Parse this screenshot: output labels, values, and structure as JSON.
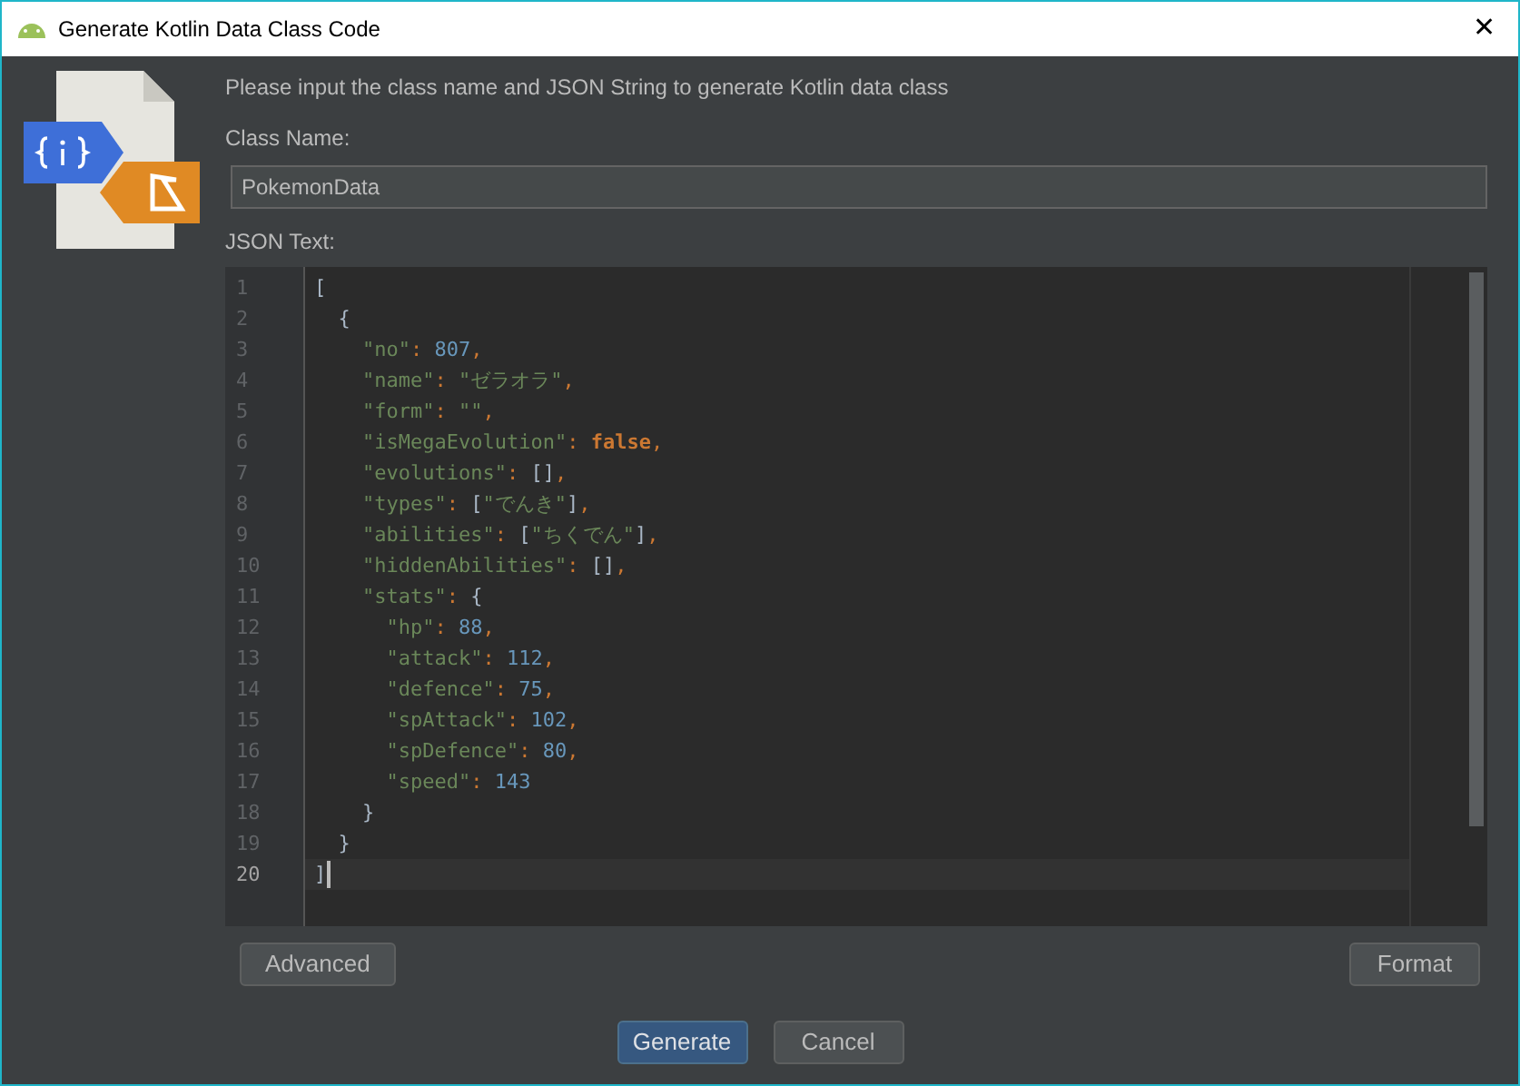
{
  "window": {
    "title": "Generate Kotlin Data Class Code",
    "close": "✕"
  },
  "instruction": "Please input the class name and JSON String to generate Kotlin data class",
  "class_name": {
    "label": "Class Name:",
    "value": "PokemonData"
  },
  "json_text": {
    "label": "JSON Text:",
    "lines": [
      {
        "number": "1",
        "current": false,
        "tokens": [
          {
            "kind": "bracket",
            "text": "["
          }
        ]
      },
      {
        "number": "2",
        "current": false,
        "tokens": [
          {
            "kind": "bracket",
            "text": "  {"
          }
        ]
      },
      {
        "number": "3",
        "current": false,
        "tokens": [
          {
            "kind": "key",
            "text": "    \"no\""
          },
          {
            "kind": "punct",
            "text": ": "
          },
          {
            "kind": "number",
            "text": "807"
          },
          {
            "kind": "punct",
            "text": ","
          }
        ]
      },
      {
        "number": "4",
        "current": false,
        "tokens": [
          {
            "kind": "key",
            "text": "    \"name\""
          },
          {
            "kind": "punct",
            "text": ": "
          },
          {
            "kind": "string",
            "text": "\"ゼラオラ\""
          },
          {
            "kind": "punct",
            "text": ","
          }
        ]
      },
      {
        "number": "5",
        "current": false,
        "tokens": [
          {
            "kind": "key",
            "text": "    \"form\""
          },
          {
            "kind": "punct",
            "text": ": "
          },
          {
            "kind": "string",
            "text": "\"\""
          },
          {
            "kind": "punct",
            "text": ","
          }
        ]
      },
      {
        "number": "6",
        "current": false,
        "tokens": [
          {
            "kind": "key",
            "text": "    \"isMegaEvolution\""
          },
          {
            "kind": "punct",
            "text": ": "
          },
          {
            "kind": "keyword",
            "text": "false"
          },
          {
            "kind": "punct",
            "text": ","
          }
        ]
      },
      {
        "number": "7",
        "current": false,
        "tokens": [
          {
            "kind": "key",
            "text": "    \"evolutions\""
          },
          {
            "kind": "punct",
            "text": ": "
          },
          {
            "kind": "bracket",
            "text": "[]"
          },
          {
            "kind": "punct",
            "text": ","
          }
        ]
      },
      {
        "number": "8",
        "current": false,
        "tokens": [
          {
            "kind": "key",
            "text": "    \"types\""
          },
          {
            "kind": "punct",
            "text": ": "
          },
          {
            "kind": "bracket",
            "text": "["
          },
          {
            "kind": "string",
            "text": "\"でんき\""
          },
          {
            "kind": "bracket",
            "text": "]"
          },
          {
            "kind": "punct",
            "text": ","
          }
        ]
      },
      {
        "number": "9",
        "current": false,
        "tokens": [
          {
            "kind": "key",
            "text": "    \"abilities\""
          },
          {
            "kind": "punct",
            "text": ": "
          },
          {
            "kind": "bracket",
            "text": "["
          },
          {
            "kind": "string",
            "text": "\"ちくでん\""
          },
          {
            "kind": "bracket",
            "text": "]"
          },
          {
            "kind": "punct",
            "text": ","
          }
        ]
      },
      {
        "number": "10",
        "current": false,
        "tokens": [
          {
            "kind": "key",
            "text": "    \"hiddenAbilities\""
          },
          {
            "kind": "punct",
            "text": ": "
          },
          {
            "kind": "bracket",
            "text": "[]"
          },
          {
            "kind": "punct",
            "text": ","
          }
        ]
      },
      {
        "number": "11",
        "current": false,
        "tokens": [
          {
            "kind": "key",
            "text": "    \"stats\""
          },
          {
            "kind": "punct",
            "text": ": "
          },
          {
            "kind": "bracket",
            "text": "{"
          }
        ]
      },
      {
        "number": "12",
        "current": false,
        "tokens": [
          {
            "kind": "key",
            "text": "      \"hp\""
          },
          {
            "kind": "punct",
            "text": ": "
          },
          {
            "kind": "number",
            "text": "88"
          },
          {
            "kind": "punct",
            "text": ","
          }
        ]
      },
      {
        "number": "13",
        "current": false,
        "tokens": [
          {
            "kind": "key",
            "text": "      \"attack\""
          },
          {
            "kind": "punct",
            "text": ": "
          },
          {
            "kind": "number",
            "text": "112"
          },
          {
            "kind": "punct",
            "text": ","
          }
        ]
      },
      {
        "number": "14",
        "current": false,
        "tokens": [
          {
            "kind": "key",
            "text": "      \"defence\""
          },
          {
            "kind": "punct",
            "text": ": "
          },
          {
            "kind": "number",
            "text": "75"
          },
          {
            "kind": "punct",
            "text": ","
          }
        ]
      },
      {
        "number": "15",
        "current": false,
        "tokens": [
          {
            "kind": "key",
            "text": "      \"spAttack\""
          },
          {
            "kind": "punct",
            "text": ": "
          },
          {
            "kind": "number",
            "text": "102"
          },
          {
            "kind": "punct",
            "text": ","
          }
        ]
      },
      {
        "number": "16",
        "current": false,
        "tokens": [
          {
            "kind": "key",
            "text": "      \"spDefence\""
          },
          {
            "kind": "punct",
            "text": ": "
          },
          {
            "kind": "number",
            "text": "80"
          },
          {
            "kind": "punct",
            "text": ","
          }
        ]
      },
      {
        "number": "17",
        "current": false,
        "tokens": [
          {
            "kind": "key",
            "text": "      \"speed\""
          },
          {
            "kind": "punct",
            "text": ": "
          },
          {
            "kind": "number",
            "text": "143"
          }
        ]
      },
      {
        "number": "18",
        "current": false,
        "tokens": [
          {
            "kind": "bracket",
            "text": "    }"
          }
        ]
      },
      {
        "number": "19",
        "current": false,
        "tokens": [
          {
            "kind": "bracket",
            "text": "  }"
          }
        ]
      },
      {
        "number": "20",
        "current": true,
        "tokens": [
          {
            "kind": "bracket",
            "text": "]"
          }
        ]
      }
    ]
  },
  "buttons": [
    {
      "label": "Advanced"
    },
    {
      "label": "Format"
    }
  ],
  "footer_buttons": [
    {
      "label": "Generate",
      "kind": "primary"
    },
    {
      "label": "Cancel",
      "kind": "secondary"
    }
  ]
}
